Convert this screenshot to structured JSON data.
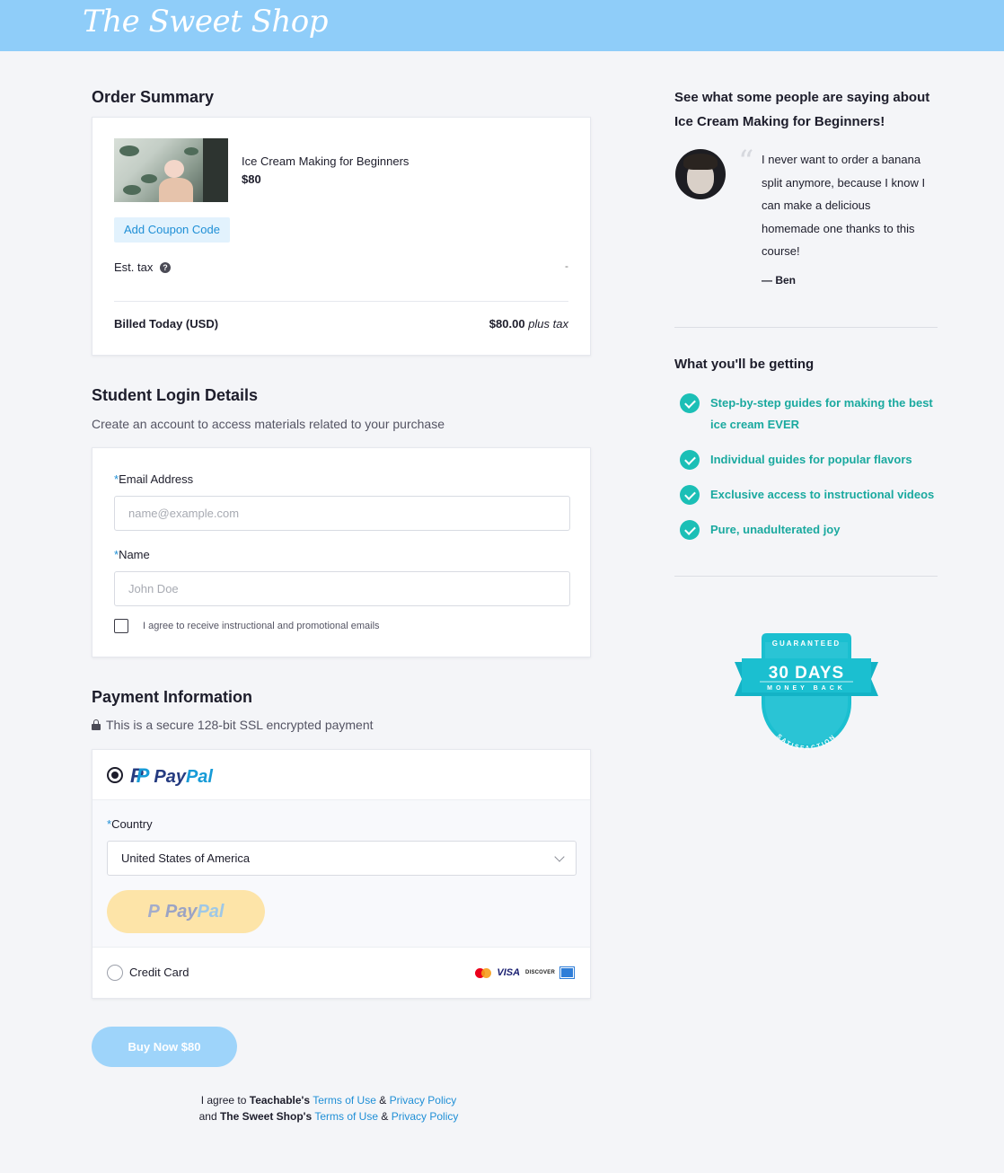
{
  "header": {
    "logo": "The Sweet Shop",
    "bg_color": "#8fcdf9"
  },
  "order_summary": {
    "title": "Order Summary",
    "product_name": "Ice Cream Making for Beginners",
    "product_price": "$80",
    "coupon_label": "Add Coupon Code",
    "tax_label": "Est. tax",
    "tax_value": "-",
    "billed_label": "Billed Today (USD)",
    "billed_amount": "$80.00",
    "billed_suffix": "plus tax"
  },
  "login": {
    "title": "Student Login Details",
    "subtitle": "Create an account to access materials related to your purchase",
    "required_mark": "*",
    "email_label": "Email Address",
    "email_placeholder": "name@example.com",
    "name_label": "Name",
    "name_placeholder": "John Doe",
    "consent_label": "I agree to receive instructional and promotional emails"
  },
  "payment": {
    "title": "Payment Information",
    "secure_note": "This is a secure 128-bit SSL encrypted payment",
    "paypal_pay": "Pay",
    "paypal_pal": "Pal",
    "country_label": "Country",
    "country_value": "United States of America",
    "credit_card_label": "Credit Card",
    "visa": "VISA",
    "discover": "DISCOVER"
  },
  "buy_button": "Buy Now $80",
  "legal": {
    "line1_prefix": "I agree to",
    "line1_company": "Teachable's",
    "line2_prefix": "and",
    "line2_company": "The Sweet Shop's",
    "terms": "Terms of Use",
    "amp": "&",
    "privacy": "Privacy Policy"
  },
  "testimonial": {
    "title": "See what some people are saying about Ice Cream Making for Beginners!",
    "quote": "I never want to order a banana split anymore, because I know I can make a delicious homemade one thanks to this course!",
    "author": "— Ben"
  },
  "benefits": {
    "title": "What you'll be getting",
    "items": [
      "Step-by-step guides for making the best ice cream EVER",
      "Individual guides for popular flavors",
      "Exclusive access to instructional videos",
      "Pure, unadulterated joy"
    ]
  },
  "badge": {
    "top": "GUARANTEED",
    "main": "30 DAYS",
    "sub": "MONEY BACK",
    "bottom": "SATISFACTION",
    "color": "#1bbfd0"
  }
}
